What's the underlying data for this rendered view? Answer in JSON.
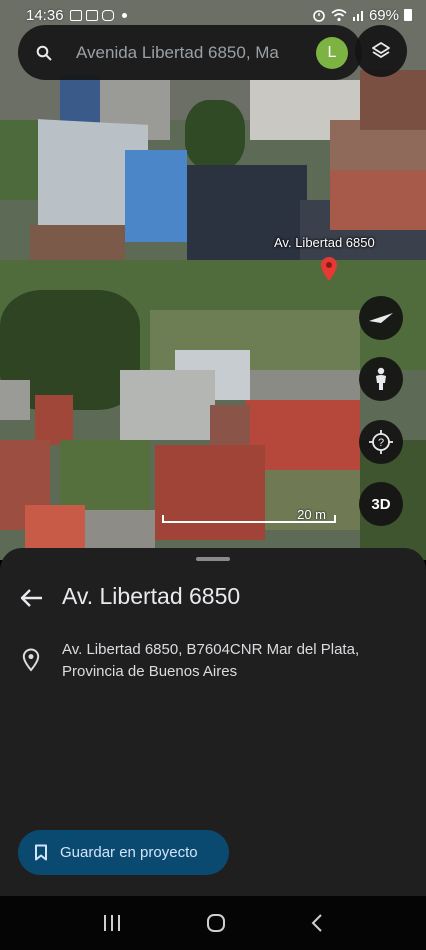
{
  "status_bar": {
    "time": "14:36",
    "battery": "69%",
    "icons": [
      "gallery-icon",
      "gmail-icon",
      "instagram-icon",
      "dot-icon",
      "alarm-icon",
      "wifi-icon",
      "signal-icon",
      "battery-icon"
    ]
  },
  "search": {
    "text": "Avenida Libertad 6850, Ma",
    "avatar_letter": "L"
  },
  "map": {
    "place_label": "Av. Libertad 6850",
    "scale_label": "20 m",
    "threed_label": "3D"
  },
  "sheet": {
    "title": "Av. Libertad 6850",
    "address": "Av. Libertad 6850, B7604CNR Mar del Plata, Provincia de Buenos Aires",
    "save_label": "Guardar en proyecto"
  },
  "colors": {
    "accent": "#7cb342",
    "pin": "#e53935",
    "save_button_bg": "#0b4a70",
    "sheet_bg": "#1f1f1f"
  }
}
